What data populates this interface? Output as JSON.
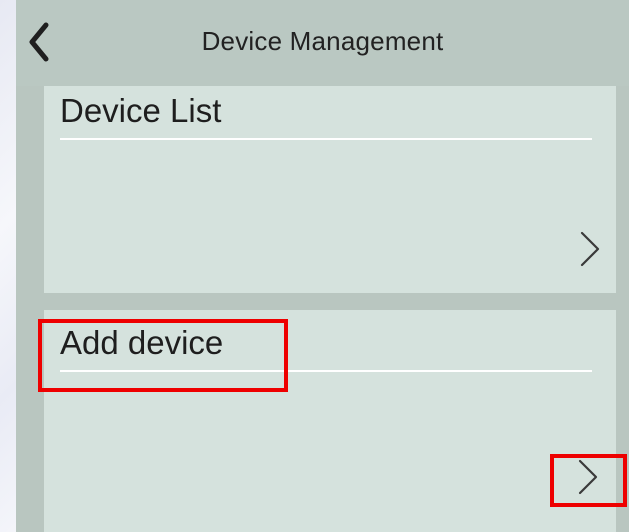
{
  "header": {
    "title": "Device Management",
    "back_icon": "chevron-left-icon"
  },
  "cards": [
    {
      "label": "Device List",
      "arrow_icon": "chevron-right-icon"
    },
    {
      "label": "Add device",
      "arrow_icon": "chevron-right-icon"
    }
  ],
  "colors": {
    "header_bg": "#bac8c2",
    "card_bg": "#d5e2dd",
    "highlight": "#ee0000"
  }
}
